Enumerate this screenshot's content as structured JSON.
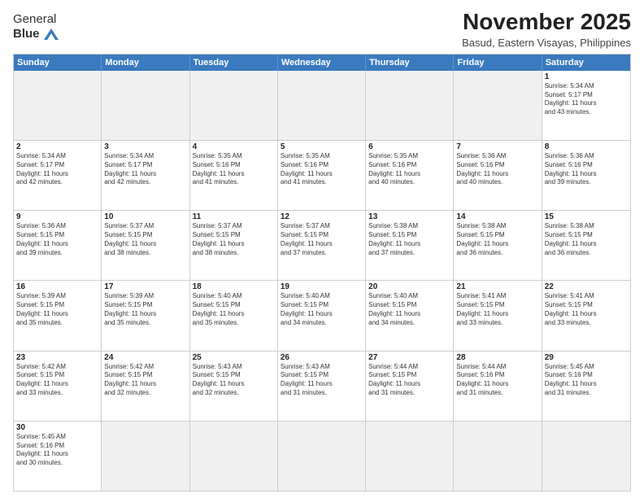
{
  "header": {
    "logo_general": "General",
    "logo_blue": "Blue",
    "title": "November 2025",
    "subtitle": "Basud, Eastern Visayas, Philippines"
  },
  "calendar": {
    "days_of_week": [
      "Sunday",
      "Monday",
      "Tuesday",
      "Wednesday",
      "Thursday",
      "Friday",
      "Saturday"
    ],
    "weeks": [
      {
        "cells": [
          {
            "day": "",
            "empty": true
          },
          {
            "day": "",
            "empty": true
          },
          {
            "day": "",
            "empty": true
          },
          {
            "day": "",
            "empty": true
          },
          {
            "day": "",
            "empty": true
          },
          {
            "day": "",
            "empty": true
          },
          {
            "day": "1",
            "info": "Sunrise: 5:34 AM\nSunset: 5:17 PM\nDaylight: 11 hours\nand 43 minutes."
          }
        ]
      },
      {
        "cells": [
          {
            "day": "2",
            "info": "Sunrise: 5:34 AM\nSunset: 5:17 PM\nDaylight: 11 hours\nand 42 minutes."
          },
          {
            "day": "3",
            "info": "Sunrise: 5:34 AM\nSunset: 5:17 PM\nDaylight: 11 hours\nand 42 minutes."
          },
          {
            "day": "4",
            "info": "Sunrise: 5:35 AM\nSunset: 5:16 PM\nDaylight: 11 hours\nand 41 minutes."
          },
          {
            "day": "5",
            "info": "Sunrise: 5:35 AM\nSunset: 5:16 PM\nDaylight: 11 hours\nand 41 minutes."
          },
          {
            "day": "6",
            "info": "Sunrise: 5:35 AM\nSunset: 5:16 PM\nDaylight: 11 hours\nand 40 minutes."
          },
          {
            "day": "7",
            "info": "Sunrise: 5:36 AM\nSunset: 5:16 PM\nDaylight: 11 hours\nand 40 minutes."
          },
          {
            "day": "8",
            "info": "Sunrise: 5:36 AM\nSunset: 5:16 PM\nDaylight: 11 hours\nand 39 minutes."
          }
        ]
      },
      {
        "cells": [
          {
            "day": "9",
            "info": "Sunrise: 5:36 AM\nSunset: 5:15 PM\nDaylight: 11 hours\nand 39 minutes."
          },
          {
            "day": "10",
            "info": "Sunrise: 5:37 AM\nSunset: 5:15 PM\nDaylight: 11 hours\nand 38 minutes."
          },
          {
            "day": "11",
            "info": "Sunrise: 5:37 AM\nSunset: 5:15 PM\nDaylight: 11 hours\nand 38 minutes."
          },
          {
            "day": "12",
            "info": "Sunrise: 5:37 AM\nSunset: 5:15 PM\nDaylight: 11 hours\nand 37 minutes."
          },
          {
            "day": "13",
            "info": "Sunrise: 5:38 AM\nSunset: 5:15 PM\nDaylight: 11 hours\nand 37 minutes."
          },
          {
            "day": "14",
            "info": "Sunrise: 5:38 AM\nSunset: 5:15 PM\nDaylight: 11 hours\nand 36 minutes."
          },
          {
            "day": "15",
            "info": "Sunrise: 5:38 AM\nSunset: 5:15 PM\nDaylight: 11 hours\nand 36 minutes."
          }
        ]
      },
      {
        "cells": [
          {
            "day": "16",
            "info": "Sunrise: 5:39 AM\nSunset: 5:15 PM\nDaylight: 11 hours\nand 35 minutes."
          },
          {
            "day": "17",
            "info": "Sunrise: 5:39 AM\nSunset: 5:15 PM\nDaylight: 11 hours\nand 35 minutes."
          },
          {
            "day": "18",
            "info": "Sunrise: 5:40 AM\nSunset: 5:15 PM\nDaylight: 11 hours\nand 35 minutes."
          },
          {
            "day": "19",
            "info": "Sunrise: 5:40 AM\nSunset: 5:15 PM\nDaylight: 11 hours\nand 34 minutes."
          },
          {
            "day": "20",
            "info": "Sunrise: 5:40 AM\nSunset: 5:15 PM\nDaylight: 11 hours\nand 34 minutes."
          },
          {
            "day": "21",
            "info": "Sunrise: 5:41 AM\nSunset: 5:15 PM\nDaylight: 11 hours\nand 33 minutes."
          },
          {
            "day": "22",
            "info": "Sunrise: 5:41 AM\nSunset: 5:15 PM\nDaylight: 11 hours\nand 33 minutes."
          }
        ]
      },
      {
        "cells": [
          {
            "day": "23",
            "info": "Sunrise: 5:42 AM\nSunset: 5:15 PM\nDaylight: 11 hours\nand 33 minutes."
          },
          {
            "day": "24",
            "info": "Sunrise: 5:42 AM\nSunset: 5:15 PM\nDaylight: 11 hours\nand 32 minutes."
          },
          {
            "day": "25",
            "info": "Sunrise: 5:43 AM\nSunset: 5:15 PM\nDaylight: 11 hours\nand 32 minutes."
          },
          {
            "day": "26",
            "info": "Sunrise: 5:43 AM\nSunset: 5:15 PM\nDaylight: 11 hours\nand 31 minutes."
          },
          {
            "day": "27",
            "info": "Sunrise: 5:44 AM\nSunset: 5:15 PM\nDaylight: 11 hours\nand 31 minutes."
          },
          {
            "day": "28",
            "info": "Sunrise: 5:44 AM\nSunset: 5:16 PM\nDaylight: 11 hours\nand 31 minutes."
          },
          {
            "day": "29",
            "info": "Sunrise: 5:45 AM\nSunset: 5:16 PM\nDaylight: 11 hours\nand 31 minutes."
          }
        ]
      },
      {
        "cells": [
          {
            "day": "30",
            "info": "Sunrise: 5:45 AM\nSunset: 5:16 PM\nDaylight: 11 hours\nand 30 minutes."
          },
          {
            "day": "",
            "empty": true
          },
          {
            "day": "",
            "empty": true
          },
          {
            "day": "",
            "empty": true
          },
          {
            "day": "",
            "empty": true
          },
          {
            "day": "",
            "empty": true
          },
          {
            "day": "",
            "empty": true
          }
        ]
      }
    ]
  }
}
